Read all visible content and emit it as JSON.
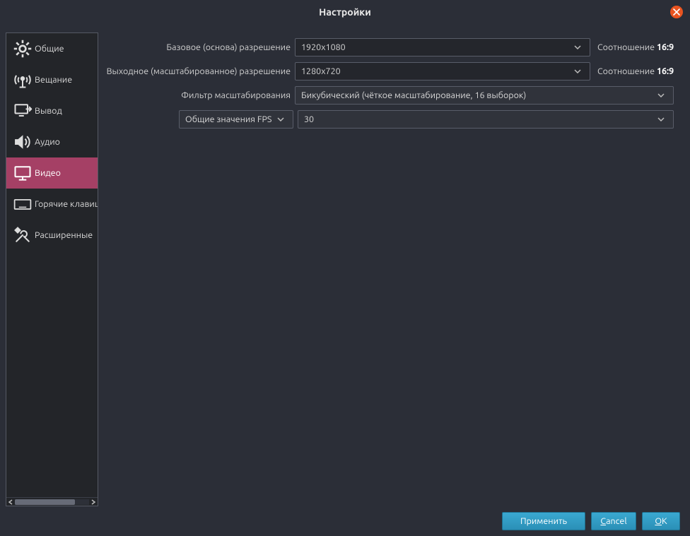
{
  "title": "Настройки",
  "sidebar": {
    "items": [
      {
        "label": "Общие"
      },
      {
        "label": "Вещание"
      },
      {
        "label": "Вывод"
      },
      {
        "label": "Аудио"
      },
      {
        "label": "Видео"
      },
      {
        "label": "Горячие клавиши"
      },
      {
        "label": "Расширенные"
      }
    ],
    "selected_index": 4
  },
  "form": {
    "base_resolution_label": "Базовое (основа) разрешение",
    "base_resolution_value": "1920x1080",
    "base_ratio_label": "Соотношение",
    "base_ratio_value": "16:9",
    "output_resolution_label": "Выходное (масштабированное) разрешение",
    "output_resolution_value": "1280x720",
    "output_ratio_label": "Соотношение",
    "output_ratio_value": "16:9",
    "downscale_filter_label": "Фильтр масштабирования",
    "downscale_filter_value": "Бикубический (чёткое масштабирование, 16 выборок)",
    "fps_type_value": "Общие значения FPS",
    "fps_value": "30"
  },
  "buttons": {
    "apply": "Применить",
    "cancel_prefix": "C",
    "cancel_rest": "ancel",
    "ok_prefix": "O",
    "ok_rest": "K"
  }
}
